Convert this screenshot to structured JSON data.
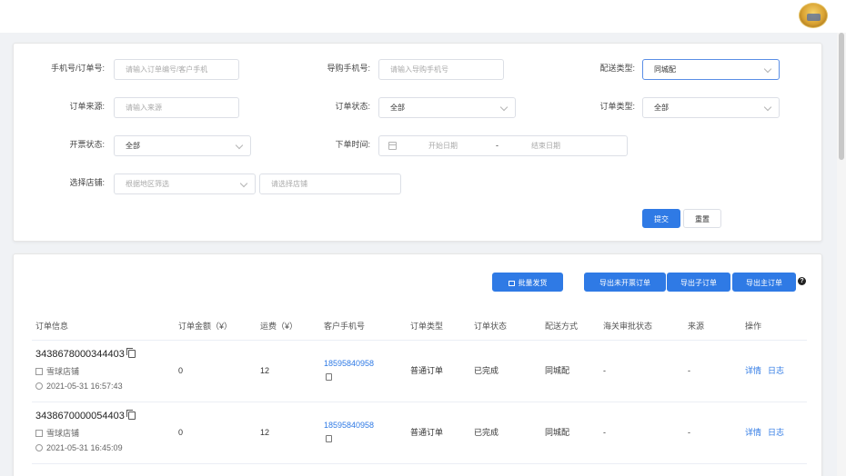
{
  "filters": {
    "phone_order_label": "手机号/订单号:",
    "phone_order_placeholder": "请输入订单编号/客户手机",
    "guide_phone_label": "导购手机号:",
    "guide_phone_placeholder": "请输入导购手机号",
    "delivery_type_label": "配送类型:",
    "delivery_type_value": "同城配",
    "order_source_label": "订单来源:",
    "order_source_placeholder": "请输入来源",
    "order_status_label": "订单状态:",
    "order_status_value": "全部",
    "order_type_label": "订单类型:",
    "order_type_value": "全部",
    "invoice_status_label": "开票状态:",
    "invoice_status_value": "全部",
    "order_time_label": "下单时间:",
    "start_date_placeholder": "开始日期",
    "range_separator": "-",
    "end_date_placeholder": "结束日期",
    "store_label": "选择店铺:",
    "region_placeholder": "根据地区筛选",
    "store_placeholder": "请选择店铺",
    "submit_label": "提交",
    "reset_label": "重置"
  },
  "toolbar": {
    "batch_ship_label": "批量发货",
    "export_uninvoiced_label": "导出未开票订单",
    "export_sub_label": "导出子订单",
    "export_main_label": "导出主订单",
    "help_glyph": "?"
  },
  "table": {
    "columns": [
      "订单信息",
      "订单金额（¥）",
      "运费（¥）",
      "客户手机号",
      "订单类型",
      "订单状态",
      "配送方式",
      "海关审批状态",
      "来源",
      "操作"
    ],
    "rows": [
      {
        "order_no": "3438678000344403",
        "store": "雪球店铺",
        "time": "2021-05-31 16:57:43",
        "amount": "0",
        "freight": "12",
        "phone": "18595840958",
        "type": "普通订单",
        "status": "已完成",
        "delivery": "同城配",
        "customs": "-",
        "source": "-",
        "detail": "详情",
        "log": "日志"
      },
      {
        "order_no": "3438670000054403",
        "store": "雪球店铺",
        "time": "2021-05-31 16:45:09",
        "amount": "0",
        "freight": "12",
        "phone": "18595840958",
        "type": "普通订单",
        "status": "已完成",
        "delivery": "同城配",
        "customs": "-",
        "source": "-",
        "detail": "详情",
        "log": "日志"
      }
    ]
  }
}
